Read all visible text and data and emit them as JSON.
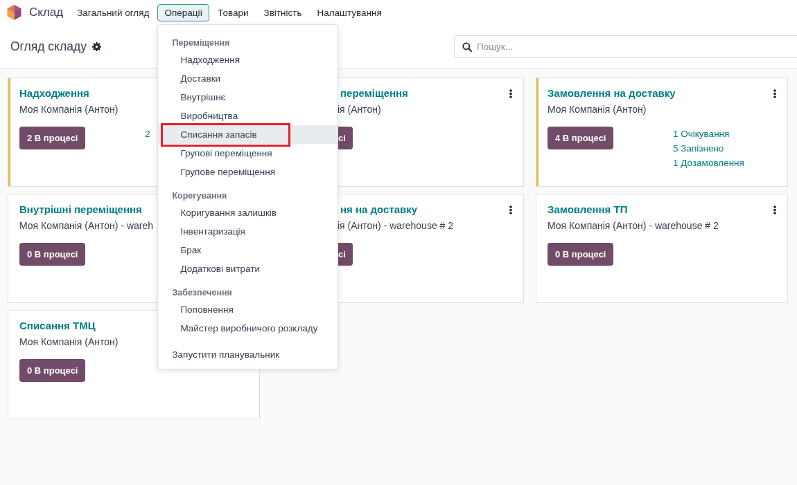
{
  "app": {
    "name": "Склад"
  },
  "nav": [
    {
      "label": "Загальний огляд",
      "expanded": false
    },
    {
      "label": "Операції",
      "expanded": true,
      "menu": {
        "sections": [
          {
            "title": "Переміщення",
            "items": [
              {
                "label": "Надходження",
                "selected": false,
                "framed": false
              },
              {
                "label": "Доставки",
                "selected": false,
                "framed": false
              },
              {
                "label": "Внутрішнє",
                "selected": false,
                "framed": false
              },
              {
                "label": "Виробництва",
                "selected": false,
                "framed": false
              },
              {
                "label": "Списання запасів",
                "selected": true,
                "framed": true
              },
              {
                "label": "Групові переміщення",
                "selected": false,
                "framed": false
              },
              {
                "label": "Групове переміщення",
                "selected": false,
                "framed": false
              }
            ]
          },
          {
            "title": "Корегування",
            "items": [
              {
                "label": "Коригування залишків",
                "selected": false,
                "framed": false
              },
              {
                "label": "Інвентаризація",
                "selected": false,
                "framed": false
              },
              {
                "label": "Брак",
                "selected": false,
                "framed": false
              },
              {
                "label": "Додаткові витрати",
                "selected": false,
                "framed": false
              }
            ]
          },
          {
            "title": "Забезпечення",
            "items": [
              {
                "label": "Поповнення",
                "selected": false,
                "framed": false
              },
              {
                "label": "Майстер виробничого розкладу",
                "selected": false,
                "framed": false
              }
            ]
          },
          {
            "items": [
              {
                "label": "Запустити планувальник",
                "selected": false,
                "framed": false
              }
            ]
          }
        ]
      }
    },
    {
      "label": "Товари",
      "expanded": false
    },
    {
      "label": "Звітність",
      "expanded": false
    },
    {
      "label": "Налаштування",
      "expanded": false
    }
  ],
  "control_panel": {
    "title": "Огляд складу",
    "search": {
      "placeholder": "Пошук..."
    }
  },
  "cards": [
    {
      "kind": "full",
      "title": "Надходження",
      "subtitle": "Моя Компанія (Антон)",
      "button": "2 В процесі",
      "links": [
        "2"
      ],
      "accent": true
    },
    {
      "kind": "covered",
      "title": "переміщення",
      "subtitle": "ія (Антон)",
      "button": "сі",
      "accent": false,
      "has_menu": true
    },
    {
      "kind": "full",
      "title": "Замовлення на доставку",
      "subtitle": "Моя Компанія (Антон)",
      "button": "4 В процесі",
      "links": [
        "1 Очікування",
        "5 Запізнено",
        "1 Дозамовлення"
      ],
      "accent": true,
      "has_menu": true
    },
    {
      "kind": "full",
      "title": "Внутрішні переміщення",
      "subtitle": "Моя Компанія (Антон) - wareh",
      "button": "0 В процесі",
      "accent": false
    },
    {
      "kind": "covered",
      "title": "ня на доставку",
      "subtitle": "ія (Антон) - warehouse # 2",
      "button": "сі",
      "accent": false,
      "has_menu": true
    },
    {
      "kind": "full",
      "title": "Замовлення ТП",
      "subtitle": "Моя Компанія (Антон) - warehouse # 2",
      "button": "0 В процесі",
      "accent": false,
      "has_menu": true
    },
    {
      "kind": "full",
      "title": "Списання ТМЦ",
      "subtitle": "Моя Компанія (Антон)",
      "button": "0 В процесі",
      "accent": false
    }
  ]
}
